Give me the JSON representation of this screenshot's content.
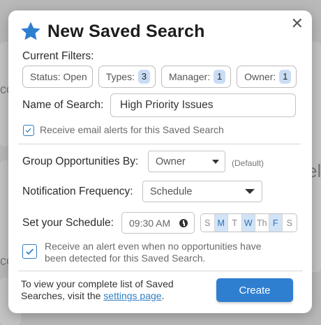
{
  "background": {
    "fragment_1": "cc",
    "fragment_2": "cc",
    "fragment_3": "el"
  },
  "modal": {
    "title": "New Saved Search",
    "title_icon": "star-icon",
    "close_icon": "close-icon",
    "close_glyph": "✕"
  },
  "filters": {
    "label": "Current Filters:",
    "chips": [
      {
        "label": "Status: Open",
        "badge": null
      },
      {
        "label": "Types:",
        "badge": "3"
      },
      {
        "label": "Manager:",
        "badge": "1"
      },
      {
        "label": "Owner:",
        "badge": "1"
      }
    ]
  },
  "search_name": {
    "label": "Name of Search:",
    "value": "High Priority Issues"
  },
  "email_alert": {
    "checked": true,
    "label": "Receive email alerts for this Saved Search"
  },
  "group_by": {
    "label": "Group Opportunities By:",
    "value": "Owner",
    "hint": "(Default)"
  },
  "frequency": {
    "label": "Notification Frequency:",
    "value": "Schedule"
  },
  "schedule": {
    "label": "Set your Schedule:",
    "time": "09:30 AM",
    "time_icon": "clock-icon",
    "days": [
      {
        "label": "S",
        "selected": false
      },
      {
        "label": "M",
        "selected": true
      },
      {
        "label": "T",
        "selected": false
      },
      {
        "label": "W",
        "selected": true
      },
      {
        "label": "Th",
        "selected": false
      },
      {
        "label": "F",
        "selected": true
      },
      {
        "label": "S",
        "selected": false
      }
    ]
  },
  "no_results_alert": {
    "checked": true,
    "label": "Receive an alert even when no opportunities have been detected for this Saved Search."
  },
  "footer": {
    "text_before": "To view your complete list of Saved Searches, visit the ",
    "link": "settings page",
    "text_after": ".",
    "create_label": "Create"
  },
  "colors": {
    "accent": "#2f7fd1",
    "badge_bg": "#c9dcf4",
    "day_selected_bg": "#d1e3f7"
  }
}
